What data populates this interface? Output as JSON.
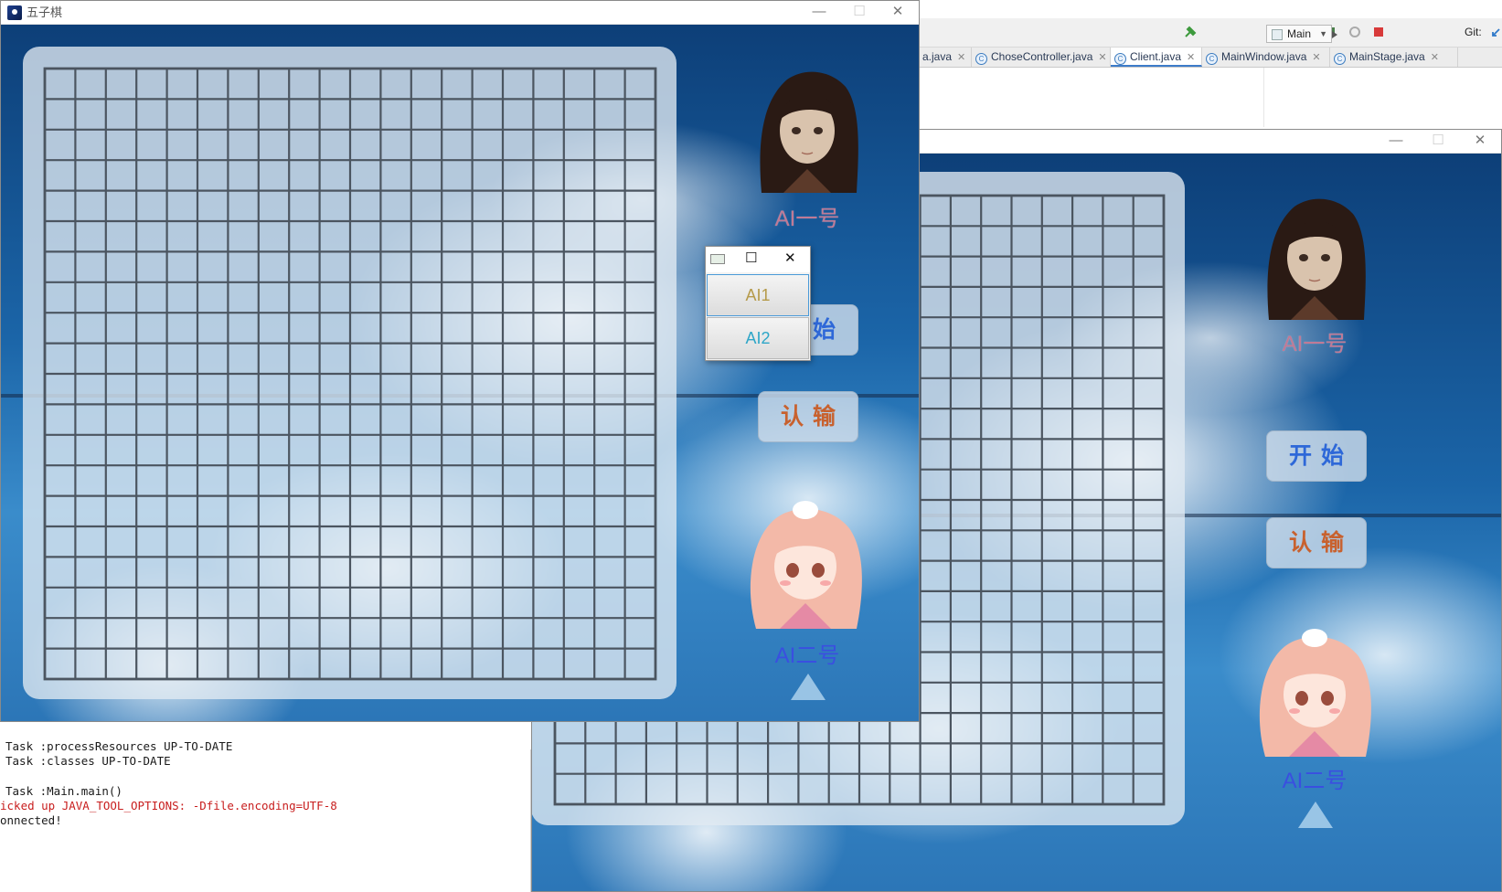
{
  "ide": {
    "run_config": "Main",
    "git_label": "Git:",
    "tabs": [
      {
        "label": "a.java",
        "icon": "class-icon"
      },
      {
        "label": "ChoseController.java",
        "icon": "class-icon"
      },
      {
        "label": "Client.java",
        "icon": "class-icon"
      },
      {
        "label": "MainWindow.java",
        "icon": "class-icon"
      },
      {
        "label": "MainStage.java",
        "icon": "class-icon"
      }
    ],
    "console_lines": [
      "Task :processResources UP-TO-DATE",
      "Task :classes UP-TO-DATE",
      "",
      "Task :Main.main()",
      "icked up JAVA_TOOL_OPTIONS: -Dfile.encoding=UTF-8",
      "onnected!"
    ]
  },
  "game_left": {
    "title": "五子棋",
    "players": {
      "ai1": "AI一号",
      "ai2": "AI二号"
    },
    "start_label": "开始",
    "resign_label": "认输"
  },
  "game_right": {
    "players": {
      "ai1": "AI一号",
      "ai2": "AI二号"
    },
    "start_label": "开始",
    "resign_label": "认输"
  },
  "chooser": {
    "options": [
      "AI1",
      "AI2"
    ]
  },
  "colors": {
    "board_line": "#4b5560",
    "ai1_label": "#c07a96",
    "ai2_label": "#3a4fe0",
    "start_text": "#2e68d8",
    "resign_text": "#c8612e"
  }
}
